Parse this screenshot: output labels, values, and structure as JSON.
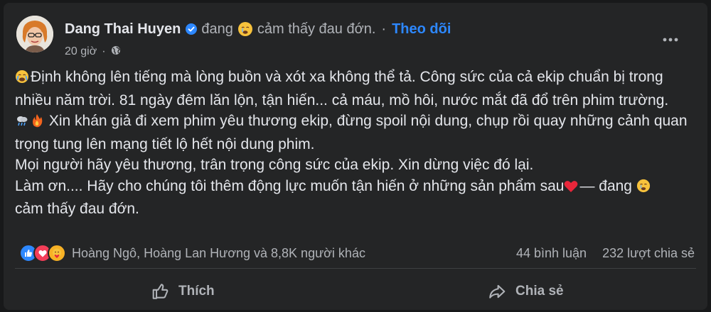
{
  "post": {
    "author": "Dang Thai Huyen",
    "feeling_prefix": "đang",
    "feeling_text": "cảm thấy đau đớn.",
    "separator": "·",
    "follow_label": "Theo dõi",
    "time": "20 giờ",
    "meta_separator": "·",
    "privacy_icon": "globe-icon",
    "body": {
      "line1": "Định không lên tiếng mà lòng buồn và xót xa không thể tả. Công sức của cả  ekip chuẩn bị trong nhiều năm trời. 81 ngày đêm lăn lộn, tận hiến... cả máu, mồ hôi, nước mắt đã đổ trên phim trường.",
      "line2": "Xin khán giả đi xem phim yêu thương ekip, đừng spoil nội dung, chụp rồi quay những cảnh quan trọng tung lên mạng tiết lộ hết nội dung phim.",
      "line3": "Mọi người hãy yêu thương, trân trọng công sức của ekip. Xin dừng việc đó lại.",
      "line4_a": "Làm ơn.... Hãy cho chúng tôi thêm động lực muốn tận hiến ở những sản phẩm sau",
      "line4_b": "— đang",
      "line4_c": "cảm thấy đau đớn."
    },
    "reactions": {
      "icons": [
        "like-icon",
        "love-icon",
        "care-icon"
      ],
      "summary": "Hoàng Ngô, Hoàng Lan Hương và 8,8K người khác",
      "comments": "44 bình luận",
      "shares": "232 lượt chia sẻ"
    },
    "actions": {
      "like_label": "Thích",
      "share_label": "Chia sẻ"
    }
  },
  "colors": {
    "page_bg": "#18191a",
    "card_bg": "#242526",
    "primary_text": "#e4e6eb",
    "secondary_text": "#b0b3b8",
    "accent": "#2d88ff",
    "divider": "#3e4042"
  }
}
